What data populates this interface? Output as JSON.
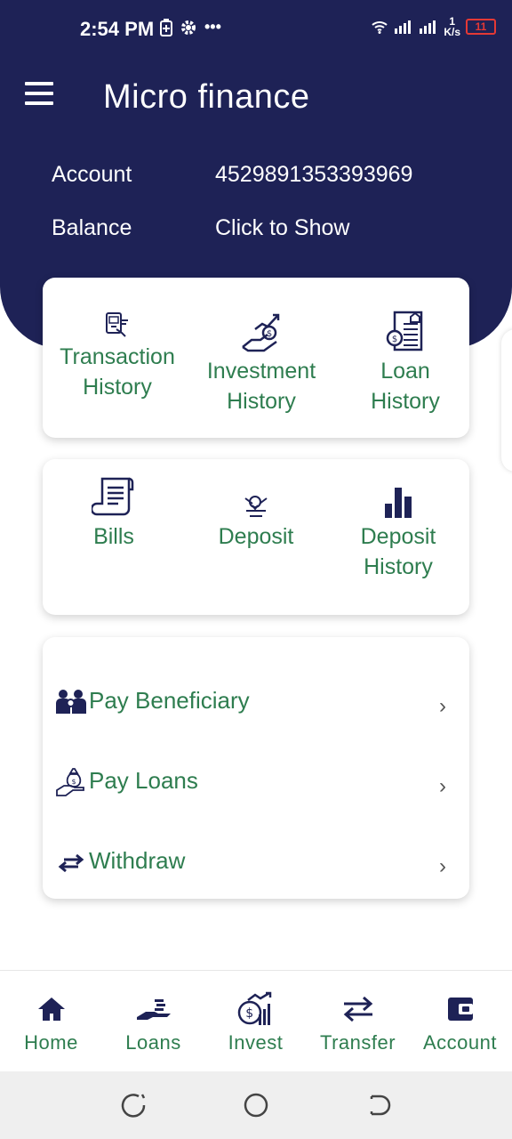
{
  "status_bar": {
    "time": "2:54 PM",
    "more": "•••",
    "speed_value": "1",
    "speed_unit": "K/s",
    "battery": "11"
  },
  "header": {
    "title": "Micro finance",
    "account_label": "Account",
    "account_value": "4529891353393969",
    "balance_label": "Balance",
    "balance_value": "Click to Show"
  },
  "history_card": {
    "items": [
      {
        "line1": "Transaction",
        "line2": "History",
        "icon": "transaction-icon"
      },
      {
        "line1": "Investment",
        "line2": "History",
        "icon": "investment-icon"
      },
      {
        "line1": "Loan",
        "line2": "History",
        "icon": "loan-document-icon"
      }
    ]
  },
  "services_card": {
    "items": [
      {
        "line1": "Bills",
        "line2": "",
        "icon": "bill-receipt-icon"
      },
      {
        "line1": "Deposit",
        "line2": "",
        "icon": "deposit-icon"
      },
      {
        "line1": "Deposit",
        "line2": "History",
        "icon": "bar-chart-icon"
      }
    ]
  },
  "actions_card": {
    "items": [
      {
        "label": "Pay Beneficiary",
        "icon": "people-icon"
      },
      {
        "label": "Pay Loans",
        "icon": "money-bag-hand-icon"
      },
      {
        "label": "Withdraw",
        "icon": "swap-arrows-icon"
      }
    ],
    "chevron": "›"
  },
  "bottom_nav": {
    "items": [
      {
        "label": "Home",
        "icon": "home-icon"
      },
      {
        "label": "Loans",
        "icon": "hand-coins-icon"
      },
      {
        "label": "Invest",
        "icon": "invest-growth-icon"
      },
      {
        "label": "Transfer",
        "icon": "transfer-arrows-icon"
      },
      {
        "label": "Account",
        "icon": "wallet-icon"
      }
    ]
  },
  "colors": {
    "primary": "#1e2256",
    "accent_text": "#2e7d4f",
    "card_bg": "#ffffff"
  }
}
